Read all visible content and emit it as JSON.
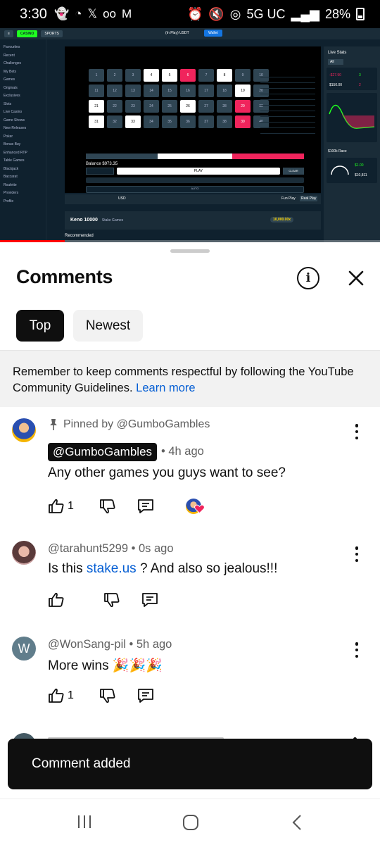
{
  "status_bar": {
    "time": "3:30",
    "network": "5G UC",
    "battery": "28%"
  },
  "video": {
    "top_nav": {
      "casino": "CASINO",
      "sports": "SPORTS",
      "wallet_label": "(In Play)",
      "currency": "USDT",
      "wallet_button": "Wallet"
    },
    "sidebar": [
      "Favourites",
      "Recent",
      "Challenges",
      "My Bets",
      "Games",
      "Originals",
      "Exclusives",
      "Slots",
      "Live Casino",
      "Game Shows",
      "New Releases",
      "Poker",
      "Bonus Buy",
      "Enhanced RTP",
      "Table Games",
      "Blackjack",
      "Baccarat",
      "Roulette",
      "Providers",
      "Profile"
    ],
    "game": {
      "cells": [
        {
          "n": 1,
          "s": ""
        },
        {
          "n": 2,
          "s": ""
        },
        {
          "n": 3,
          "s": ""
        },
        {
          "n": 4,
          "s": "sel"
        },
        {
          "n": 5,
          "s": "sel"
        },
        {
          "n": 6,
          "s": "hit"
        },
        {
          "n": 7,
          "s": ""
        },
        {
          "n": 8,
          "s": "sel"
        },
        {
          "n": 9,
          "s": ""
        },
        {
          "n": 10,
          "s": ""
        },
        {
          "n": 11,
          "s": ""
        },
        {
          "n": 12,
          "s": ""
        },
        {
          "n": 13,
          "s": ""
        },
        {
          "n": 14,
          "s": ""
        },
        {
          "n": 15,
          "s": ""
        },
        {
          "n": 16,
          "s": ""
        },
        {
          "n": 17,
          "s": ""
        },
        {
          "n": 18,
          "s": ""
        },
        {
          "n": 19,
          "s": "sel"
        },
        {
          "n": 20,
          "s": ""
        },
        {
          "n": 21,
          "s": "sel"
        },
        {
          "n": 22,
          "s": ""
        },
        {
          "n": 23,
          "s": ""
        },
        {
          "n": 24,
          "s": ""
        },
        {
          "n": 25,
          "s": ""
        },
        {
          "n": 26,
          "s": "sel"
        },
        {
          "n": 27,
          "s": ""
        },
        {
          "n": 28,
          "s": ""
        },
        {
          "n": 29,
          "s": "hit"
        },
        {
          "n": 30,
          "s": ""
        },
        {
          "n": 31,
          "s": "sel"
        },
        {
          "n": 32,
          "s": ""
        },
        {
          "n": 33,
          "s": "sel"
        },
        {
          "n": 34,
          "s": ""
        },
        {
          "n": 35,
          "s": ""
        },
        {
          "n": 36,
          "s": ""
        },
        {
          "n": 37,
          "s": ""
        },
        {
          "n": 38,
          "s": ""
        },
        {
          "n": 39,
          "s": "hit"
        },
        {
          "n": 40,
          "s": ""
        }
      ],
      "balance": "$973.35",
      "play_button": "PLAY",
      "auto_button": "AUTO",
      "clear_button": "CLEAR"
    },
    "live_stats": {
      "title": "Live Stats",
      "filter": "All",
      "profit": "-$27.90",
      "wins": "3",
      "wagered": "$150.00",
      "losses": "2"
    },
    "race": {
      "title": "$100k Race",
      "prize": "$1.00",
      "wagered": "$10,811"
    },
    "bottom": {
      "currency": "USD",
      "fun_play": "Fun Play",
      "real_play": "Real Play"
    },
    "title_bar": {
      "game": "Keno 10000",
      "studio": "Stake Games",
      "prize": "10,000.00x"
    },
    "recommended": "Recommended",
    "progress": 0.17
  },
  "sheet": {
    "title": "Comments",
    "tabs": [
      "Top",
      "Newest"
    ],
    "guidelines_text": "Remember to keep comments respectful by following the YouTube Community Guidelines.",
    "guidelines_link": "Learn more",
    "comments": [
      {
        "pinned_label": "Pinned by @GumboGambles",
        "author": "@GumboGambles",
        "time": "• 4h ago",
        "text": "Any other games you guys want to see?",
        "likes": "1"
      },
      {
        "author": "@tarahunt5299",
        "time": "• 0s ago",
        "text_before": "Is this ",
        "link": "stake.us",
        "text_after": " ? And also so jealous!!!"
      },
      {
        "avatar_letter": "W",
        "author": "@WonSang-pil",
        "time": "• 5h ago",
        "text": "More wins 🎉🎉🎉",
        "likes": "1"
      }
    ],
    "toast": "Comment added"
  }
}
